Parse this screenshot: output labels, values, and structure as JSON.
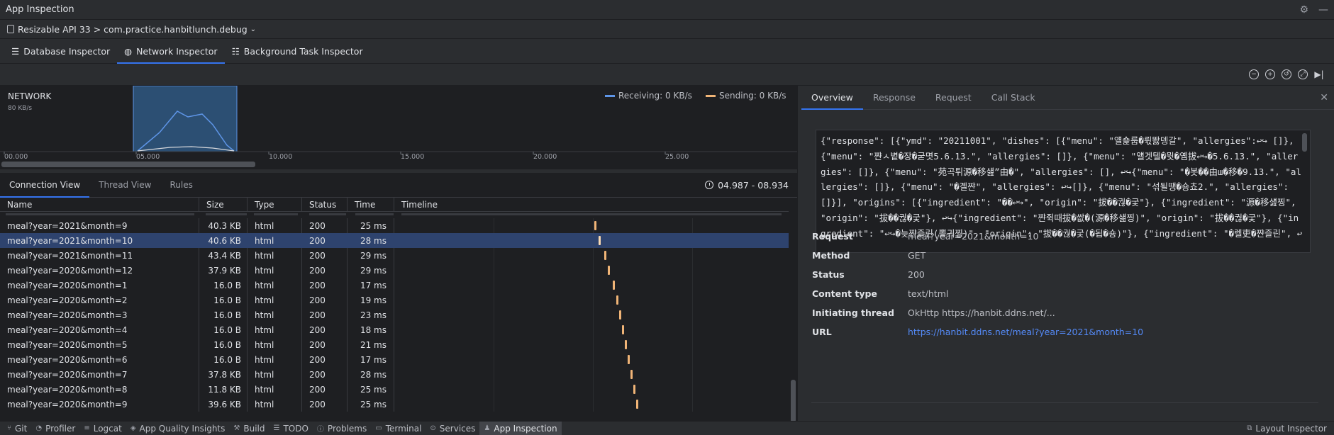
{
  "window": {
    "title": "App Inspection"
  },
  "device": {
    "label": "Resizable API 33 > com.practice.hanbitlunch.debug"
  },
  "inspector_tabs": [
    {
      "label": "Database Inspector",
      "icon": "database-icon"
    },
    {
      "label": "Network Inspector",
      "icon": "network-icon",
      "active": true
    },
    {
      "label": "Background Task Inspector",
      "icon": "list-icon"
    }
  ],
  "chart": {
    "title": "NETWORK",
    "y_label": "80 KB/s",
    "legend": {
      "receiving": "Receiving: 0 KB/s",
      "sending": "Sending: 0 KB/s"
    },
    "colors": {
      "receiving": "#5e95e7",
      "sending": "#f0b477",
      "selection": "#2c4f73"
    },
    "x_ticks": [
      "00.000",
      "05.000",
      "10.000",
      "15.000",
      "20.000",
      "25.000"
    ]
  },
  "connection_tabs": [
    {
      "label": "Connection View",
      "active": true
    },
    {
      "label": "Thread View"
    },
    {
      "label": "Rules"
    }
  ],
  "time_range": "04.987 - 08.934",
  "table": {
    "columns": [
      "Name",
      "Size",
      "Type",
      "Status",
      "Time",
      "Timeline"
    ],
    "rows": [
      {
        "name": "meal?year=2021&month=9",
        "size": "40.3 KB",
        "type": "html",
        "status": "200",
        "time": "25 ms"
      },
      {
        "name": "meal?year=2021&month=10",
        "size": "40.6 KB",
        "type": "html",
        "status": "200",
        "time": "28 ms",
        "selected": true
      },
      {
        "name": "meal?year=2021&month=11",
        "size": "43.4 KB",
        "type": "html",
        "status": "200",
        "time": "29 ms"
      },
      {
        "name": "meal?year=2020&month=12",
        "size": "37.9 KB",
        "type": "html",
        "status": "200",
        "time": "29 ms"
      },
      {
        "name": "meal?year=2020&month=1",
        "size": "16.0 B",
        "type": "html",
        "status": "200",
        "time": "17 ms"
      },
      {
        "name": "meal?year=2020&month=2",
        "size": "16.0 B",
        "type": "html",
        "status": "200",
        "time": "19 ms"
      },
      {
        "name": "meal?year=2020&month=3",
        "size": "16.0 B",
        "type": "html",
        "status": "200",
        "time": "23 ms"
      },
      {
        "name": "meal?year=2020&month=4",
        "size": "16.0 B",
        "type": "html",
        "status": "200",
        "time": "18 ms"
      },
      {
        "name": "meal?year=2020&month=5",
        "size": "16.0 B",
        "type": "html",
        "status": "200",
        "time": "21 ms"
      },
      {
        "name": "meal?year=2020&month=6",
        "size": "16.0 B",
        "type": "html",
        "status": "200",
        "time": "17 ms"
      },
      {
        "name": "meal?year=2020&month=7",
        "size": "37.8 KB",
        "type": "html",
        "status": "200",
        "time": "28 ms"
      },
      {
        "name": "meal?year=2020&month=8",
        "size": "11.8 KB",
        "type": "html",
        "status": "200",
        "time": "25 ms"
      },
      {
        "name": "meal?year=2020&month=9",
        "size": "39.6 KB",
        "type": "html",
        "status": "200",
        "time": "25 ms"
      }
    ]
  },
  "detail_tabs": [
    {
      "label": "Overview",
      "active": true
    },
    {
      "label": "Response"
    },
    {
      "label": "Request"
    },
    {
      "label": "Call Stack"
    }
  ],
  "response_body": "{\"response\": [{\"ymd\": \"20211001\", \"dishes\": [{\"menu\": \"얠숉룹�뤿똻뎅갈\", \"allergies\":↩↪ []}, {\"menu\": \"쨘ㅅ볕�장�굳몃5.6.13.\", \"allergies\": []}, {\"menu\": \"얠겟텔�뮛�옘拔↩↪�5.6.13.\", \"allergies\": []}, {\"menu\": \"苑곡튀源�移섎”由�\", \"allergies\": [], ↩↪{\"menu\": \"�봇��由ш�移�9.13.\", \"allergies\": []}, {\"menu\": \"�곌쨘\", \"allergies\": ↩↪[]}, {\"menu\": \"섞될땡�숑쵸2.\", \"allergies\": []}], \"origins\": [{\"ingredient\": \"��↩↪\", \"origin\": \"拔��궎�궃\"}, {\"ingredient\": \"源�移섎찡\", \"origin\": \"拔��궎�궃\"}, ↩↪{\"ingredient\": \"쨘쥑때拔�쌊�(源�移섎찡)\", \"origin\": \"拔��궎�궃\"}, {\"ingredient\": \"↩↪�늦쨘즐린(뽈귀찡)\", \"origin\": \"拔��궎�궃(�됩�숑)\"}, {\"ingredient\": \"�렐吏�쨘즐린\", ↩",
  "details": {
    "request": {
      "label": "Request",
      "value": "meal?year=2021&month=10"
    },
    "method": {
      "label": "Method",
      "value": "GET"
    },
    "status": {
      "label": "Status",
      "value": "200"
    },
    "content_type": {
      "label": "Content type",
      "value": "text/html"
    },
    "initiating_thread": {
      "label": "Initiating thread",
      "value": "OkHttp https://hanbit.ddns.net/..."
    },
    "url": {
      "label": "URL",
      "value": "https://hanbit.ddns.net/meal?year=2021&month=10"
    }
  },
  "status_bar": {
    "items": [
      {
        "label": "Git",
        "icon": "git-icon"
      },
      {
        "label": "Profiler",
        "icon": "profiler-icon"
      },
      {
        "label": "Logcat",
        "icon": "logcat-icon"
      },
      {
        "label": "App Quality Insights",
        "icon": "insights-icon"
      },
      {
        "label": "Build",
        "icon": "build-icon"
      },
      {
        "label": "TODO",
        "icon": "todo-icon"
      },
      {
        "label": "Problems",
        "icon": "problems-icon"
      },
      {
        "label": "Terminal",
        "icon": "terminal-icon"
      },
      {
        "label": "Services",
        "icon": "services-icon"
      },
      {
        "label": "App Inspection",
        "icon": "app-inspection-icon",
        "active": true
      }
    ],
    "right": "Layout Inspector"
  }
}
